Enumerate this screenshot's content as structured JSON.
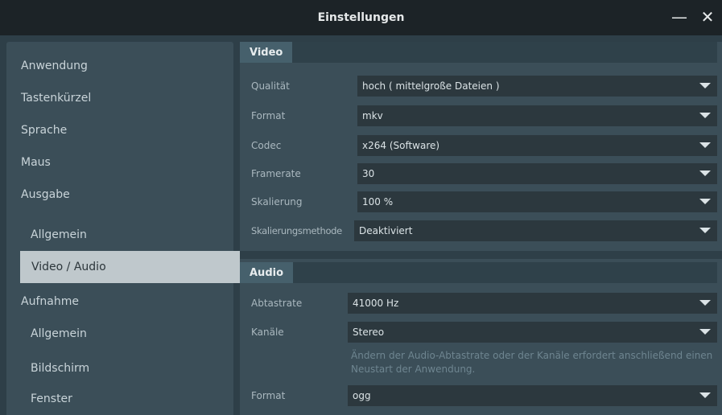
{
  "window": {
    "title": "Einstellungen",
    "minimize_symbol": "—",
    "close_symbol": "✕"
  },
  "sidebar": {
    "items": [
      {
        "label": "Anwendung"
      },
      {
        "label": "Tastenkürzel"
      },
      {
        "label": "Sprache"
      },
      {
        "label": "Maus"
      },
      {
        "label": "Ausgabe"
      },
      {
        "label": "Allgemein"
      },
      {
        "label": "Video / Audio",
        "selected": true
      },
      {
        "label": "Aufnahme"
      },
      {
        "label": "Allgemein"
      },
      {
        "label": "Bildschirm"
      },
      {
        "label": "Fenster"
      }
    ]
  },
  "video": {
    "heading": "Video",
    "rows": [
      {
        "label": "Qualität",
        "value": "hoch ( mittelgroße Dateien )"
      },
      {
        "label": "Format",
        "value": "mkv"
      },
      {
        "label": "Codec",
        "value": "x264 (Software)"
      },
      {
        "label": "Framerate",
        "value": "30"
      },
      {
        "label": "Skalierung",
        "value": "100 %"
      },
      {
        "label": "Skalierungsmethode",
        "value": "Deaktiviert"
      }
    ]
  },
  "audio": {
    "heading": "Audio",
    "rows": [
      {
        "label": "Abtastrate",
        "value": "41000 Hz"
      },
      {
        "label": "Kanäle",
        "value": "Stereo"
      },
      {
        "label": "Format",
        "value": "ogg"
      }
    ],
    "note": "Ändern der Audio-Abtastrate oder der Kanäle erfordert anschließend einen Neustart der Anwendung."
  },
  "colors": {
    "titlebar": "#1c2327",
    "panel": "#3b4e58",
    "selected": "#bfc8cc",
    "select_bg": "#2c383e"
  },
  "icons": {
    "minimize": "minimize-icon",
    "close": "close-icon",
    "dropdown": "chevron-down-icon"
  }
}
